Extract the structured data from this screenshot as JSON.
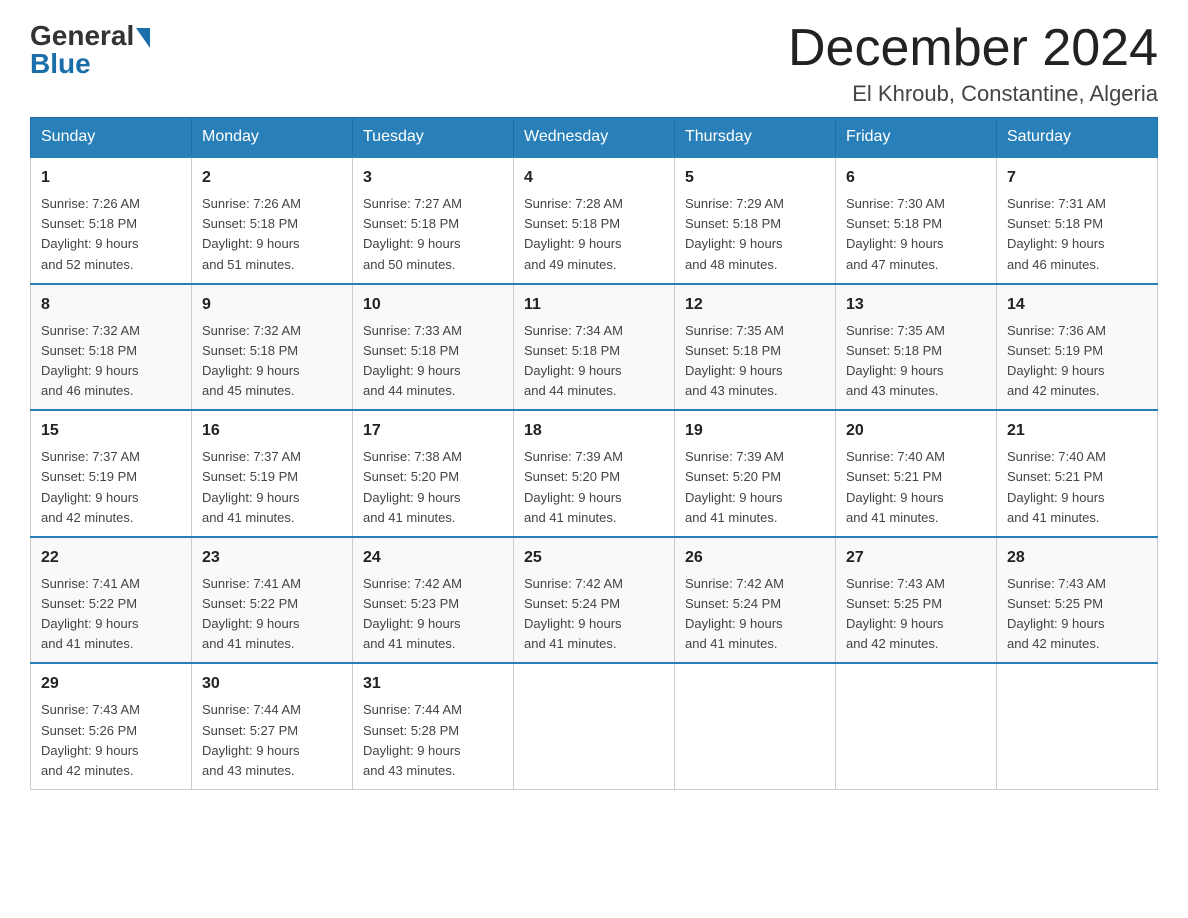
{
  "logo": {
    "general": "General",
    "blue": "Blue"
  },
  "header": {
    "month_year": "December 2024",
    "location": "El Khroub, Constantine, Algeria"
  },
  "days_of_week": [
    "Sunday",
    "Monday",
    "Tuesday",
    "Wednesday",
    "Thursday",
    "Friday",
    "Saturday"
  ],
  "weeks": [
    [
      {
        "day": "1",
        "sunrise": "7:26 AM",
        "sunset": "5:18 PM",
        "daylight": "9 hours and 52 minutes."
      },
      {
        "day": "2",
        "sunrise": "7:26 AM",
        "sunset": "5:18 PM",
        "daylight": "9 hours and 51 minutes."
      },
      {
        "day": "3",
        "sunrise": "7:27 AM",
        "sunset": "5:18 PM",
        "daylight": "9 hours and 50 minutes."
      },
      {
        "day": "4",
        "sunrise": "7:28 AM",
        "sunset": "5:18 PM",
        "daylight": "9 hours and 49 minutes."
      },
      {
        "day": "5",
        "sunrise": "7:29 AM",
        "sunset": "5:18 PM",
        "daylight": "9 hours and 48 minutes."
      },
      {
        "day": "6",
        "sunrise": "7:30 AM",
        "sunset": "5:18 PM",
        "daylight": "9 hours and 47 minutes."
      },
      {
        "day": "7",
        "sunrise": "7:31 AM",
        "sunset": "5:18 PM",
        "daylight": "9 hours and 46 minutes."
      }
    ],
    [
      {
        "day": "8",
        "sunrise": "7:32 AM",
        "sunset": "5:18 PM",
        "daylight": "9 hours and 46 minutes."
      },
      {
        "day": "9",
        "sunrise": "7:32 AM",
        "sunset": "5:18 PM",
        "daylight": "9 hours and 45 minutes."
      },
      {
        "day": "10",
        "sunrise": "7:33 AM",
        "sunset": "5:18 PM",
        "daylight": "9 hours and 44 minutes."
      },
      {
        "day": "11",
        "sunrise": "7:34 AM",
        "sunset": "5:18 PM",
        "daylight": "9 hours and 44 minutes."
      },
      {
        "day": "12",
        "sunrise": "7:35 AM",
        "sunset": "5:18 PM",
        "daylight": "9 hours and 43 minutes."
      },
      {
        "day": "13",
        "sunrise": "7:35 AM",
        "sunset": "5:18 PM",
        "daylight": "9 hours and 43 minutes."
      },
      {
        "day": "14",
        "sunrise": "7:36 AM",
        "sunset": "5:19 PM",
        "daylight": "9 hours and 42 minutes."
      }
    ],
    [
      {
        "day": "15",
        "sunrise": "7:37 AM",
        "sunset": "5:19 PM",
        "daylight": "9 hours and 42 minutes."
      },
      {
        "day": "16",
        "sunrise": "7:37 AM",
        "sunset": "5:19 PM",
        "daylight": "9 hours and 41 minutes."
      },
      {
        "day": "17",
        "sunrise": "7:38 AM",
        "sunset": "5:20 PM",
        "daylight": "9 hours and 41 minutes."
      },
      {
        "day": "18",
        "sunrise": "7:39 AM",
        "sunset": "5:20 PM",
        "daylight": "9 hours and 41 minutes."
      },
      {
        "day": "19",
        "sunrise": "7:39 AM",
        "sunset": "5:20 PM",
        "daylight": "9 hours and 41 minutes."
      },
      {
        "day": "20",
        "sunrise": "7:40 AM",
        "sunset": "5:21 PM",
        "daylight": "9 hours and 41 minutes."
      },
      {
        "day": "21",
        "sunrise": "7:40 AM",
        "sunset": "5:21 PM",
        "daylight": "9 hours and 41 minutes."
      }
    ],
    [
      {
        "day": "22",
        "sunrise": "7:41 AM",
        "sunset": "5:22 PM",
        "daylight": "9 hours and 41 minutes."
      },
      {
        "day": "23",
        "sunrise": "7:41 AM",
        "sunset": "5:22 PM",
        "daylight": "9 hours and 41 minutes."
      },
      {
        "day": "24",
        "sunrise": "7:42 AM",
        "sunset": "5:23 PM",
        "daylight": "9 hours and 41 minutes."
      },
      {
        "day": "25",
        "sunrise": "7:42 AM",
        "sunset": "5:24 PM",
        "daylight": "9 hours and 41 minutes."
      },
      {
        "day": "26",
        "sunrise": "7:42 AM",
        "sunset": "5:24 PM",
        "daylight": "9 hours and 41 minutes."
      },
      {
        "day": "27",
        "sunrise": "7:43 AM",
        "sunset": "5:25 PM",
        "daylight": "9 hours and 42 minutes."
      },
      {
        "day": "28",
        "sunrise": "7:43 AM",
        "sunset": "5:25 PM",
        "daylight": "9 hours and 42 minutes."
      }
    ],
    [
      {
        "day": "29",
        "sunrise": "7:43 AM",
        "sunset": "5:26 PM",
        "daylight": "9 hours and 42 minutes."
      },
      {
        "day": "30",
        "sunrise": "7:44 AM",
        "sunset": "5:27 PM",
        "daylight": "9 hours and 43 minutes."
      },
      {
        "day": "31",
        "sunrise": "7:44 AM",
        "sunset": "5:28 PM",
        "daylight": "9 hours and 43 minutes."
      },
      null,
      null,
      null,
      null
    ]
  ],
  "labels": {
    "sunrise": "Sunrise:",
    "sunset": "Sunset:",
    "daylight": "Daylight:"
  }
}
